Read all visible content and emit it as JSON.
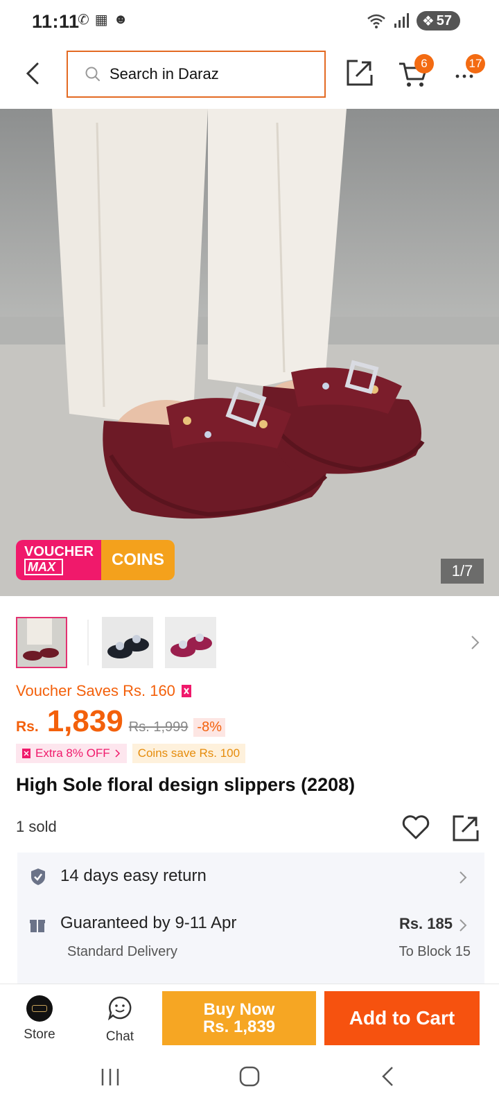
{
  "status_bar": {
    "time": "11:11",
    "left_icons": [
      "whatsapp-icon",
      "screenshot-icon",
      "snapchat-icon"
    ],
    "right_icons": [
      "wifi-icon",
      "signal-icon"
    ],
    "battery": "57"
  },
  "header": {
    "search_placeholder": "Search in Daraz",
    "cart_count": "6",
    "more_count": "17"
  },
  "gallery": {
    "counter": "1/7",
    "voucher_tag_line1": "VOUCHER",
    "voucher_tag_line2": "MAX",
    "coins_tag": "COINS",
    "thumbnails": [
      "maroon-slippers",
      "black-slippers",
      "pink-slippers"
    ]
  },
  "product": {
    "voucher_saves": "Voucher Saves Rs. 160",
    "currency": "Rs.",
    "price": "1,839",
    "original_price": "Rs. 1,999",
    "discount": "-8%",
    "promo_extra": "Extra 8% OFF",
    "promo_coins": "Coins save Rs. 100",
    "title": "High Sole floral design slippers (2208)",
    "sold": "1 sold"
  },
  "info": {
    "return_text": "14 days easy return",
    "delivery_text": "Guaranteed by 9-11 Apr",
    "delivery_sub": "Standard Delivery",
    "delivery_price": "Rs. 185",
    "delivery_location": "To Block 15"
  },
  "actions": {
    "store_label": "Store",
    "chat_label": "Chat",
    "buy_now_line1": "Buy Now",
    "buy_now_line2": "Rs. 1,839",
    "add_to_cart": "Add to Cart"
  },
  "colors": {
    "brand_orange": "#f6520f",
    "price_orange": "#f3600b",
    "buy_now": "#f6a623",
    "voucher_pink": "#f0196b"
  }
}
